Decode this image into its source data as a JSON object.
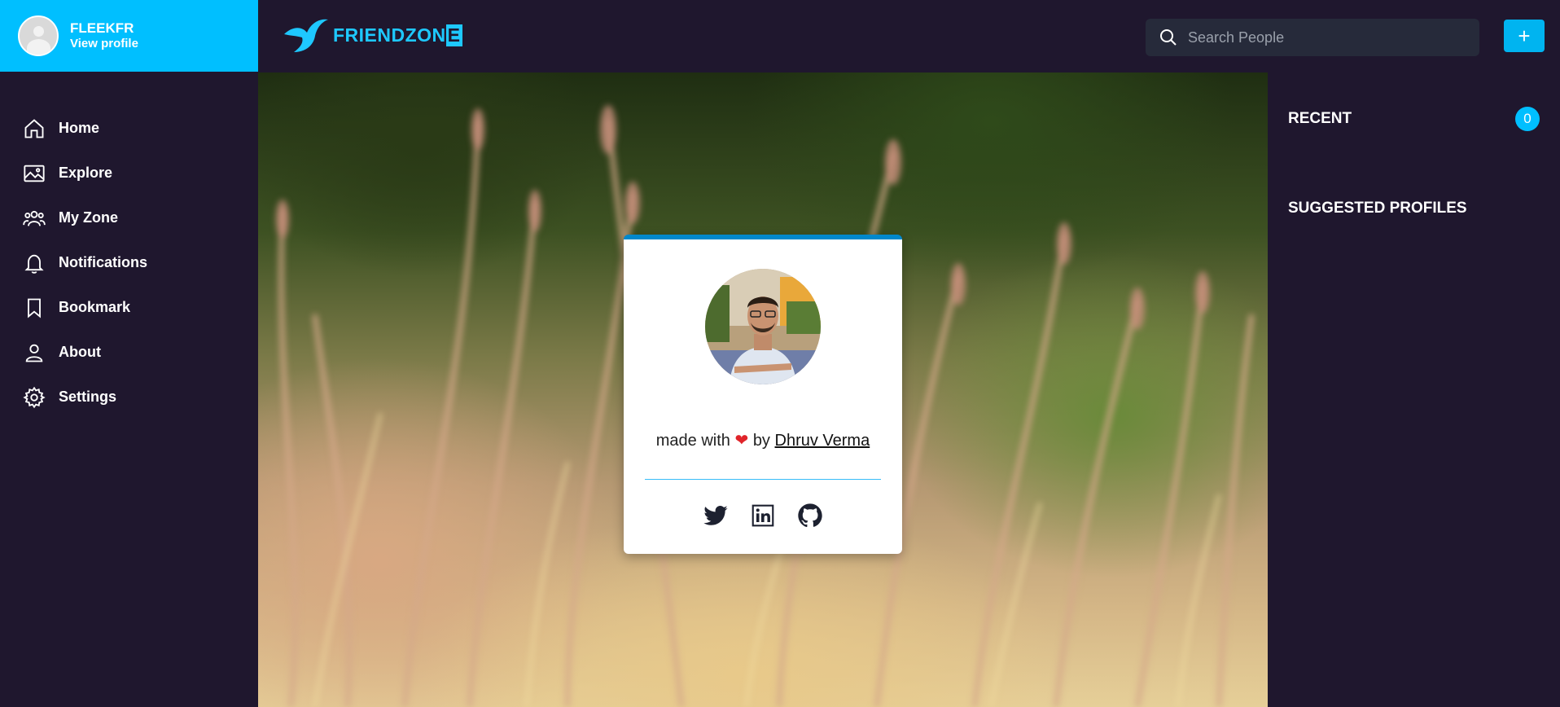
{
  "profile": {
    "name": "FLEEKFR",
    "link": "View profile"
  },
  "logo": {
    "text": "FRIENDZON",
    "last_letter": "E"
  },
  "search": {
    "placeholder": "Search People"
  },
  "add_button": {
    "label": "+"
  },
  "nav": {
    "items": [
      {
        "label": "Home",
        "icon": "home-icon"
      },
      {
        "label": "Explore",
        "icon": "image-icon"
      },
      {
        "label": "My Zone",
        "icon": "users-icon"
      },
      {
        "label": "Notifications",
        "icon": "bell-icon"
      },
      {
        "label": "Bookmark",
        "icon": "bookmark-icon"
      },
      {
        "label": "About",
        "icon": "user-icon"
      },
      {
        "label": "Settings",
        "icon": "gear-icon"
      }
    ]
  },
  "card": {
    "made_with": "made with",
    "by": "by",
    "heart": "❤",
    "author": "Dhruv Verma",
    "socials": [
      "twitter-icon",
      "linkedin-icon",
      "github-icon"
    ]
  },
  "right": {
    "recent_title": "RECENT",
    "recent_count": "0",
    "suggested_title": "SUGGESTED PROFILES"
  },
  "colors": {
    "accent": "#00bfff",
    "background": "#1f172e",
    "search_bg": "#262a3a",
    "card_top": "#0088cc",
    "heart": "#e0242a"
  }
}
